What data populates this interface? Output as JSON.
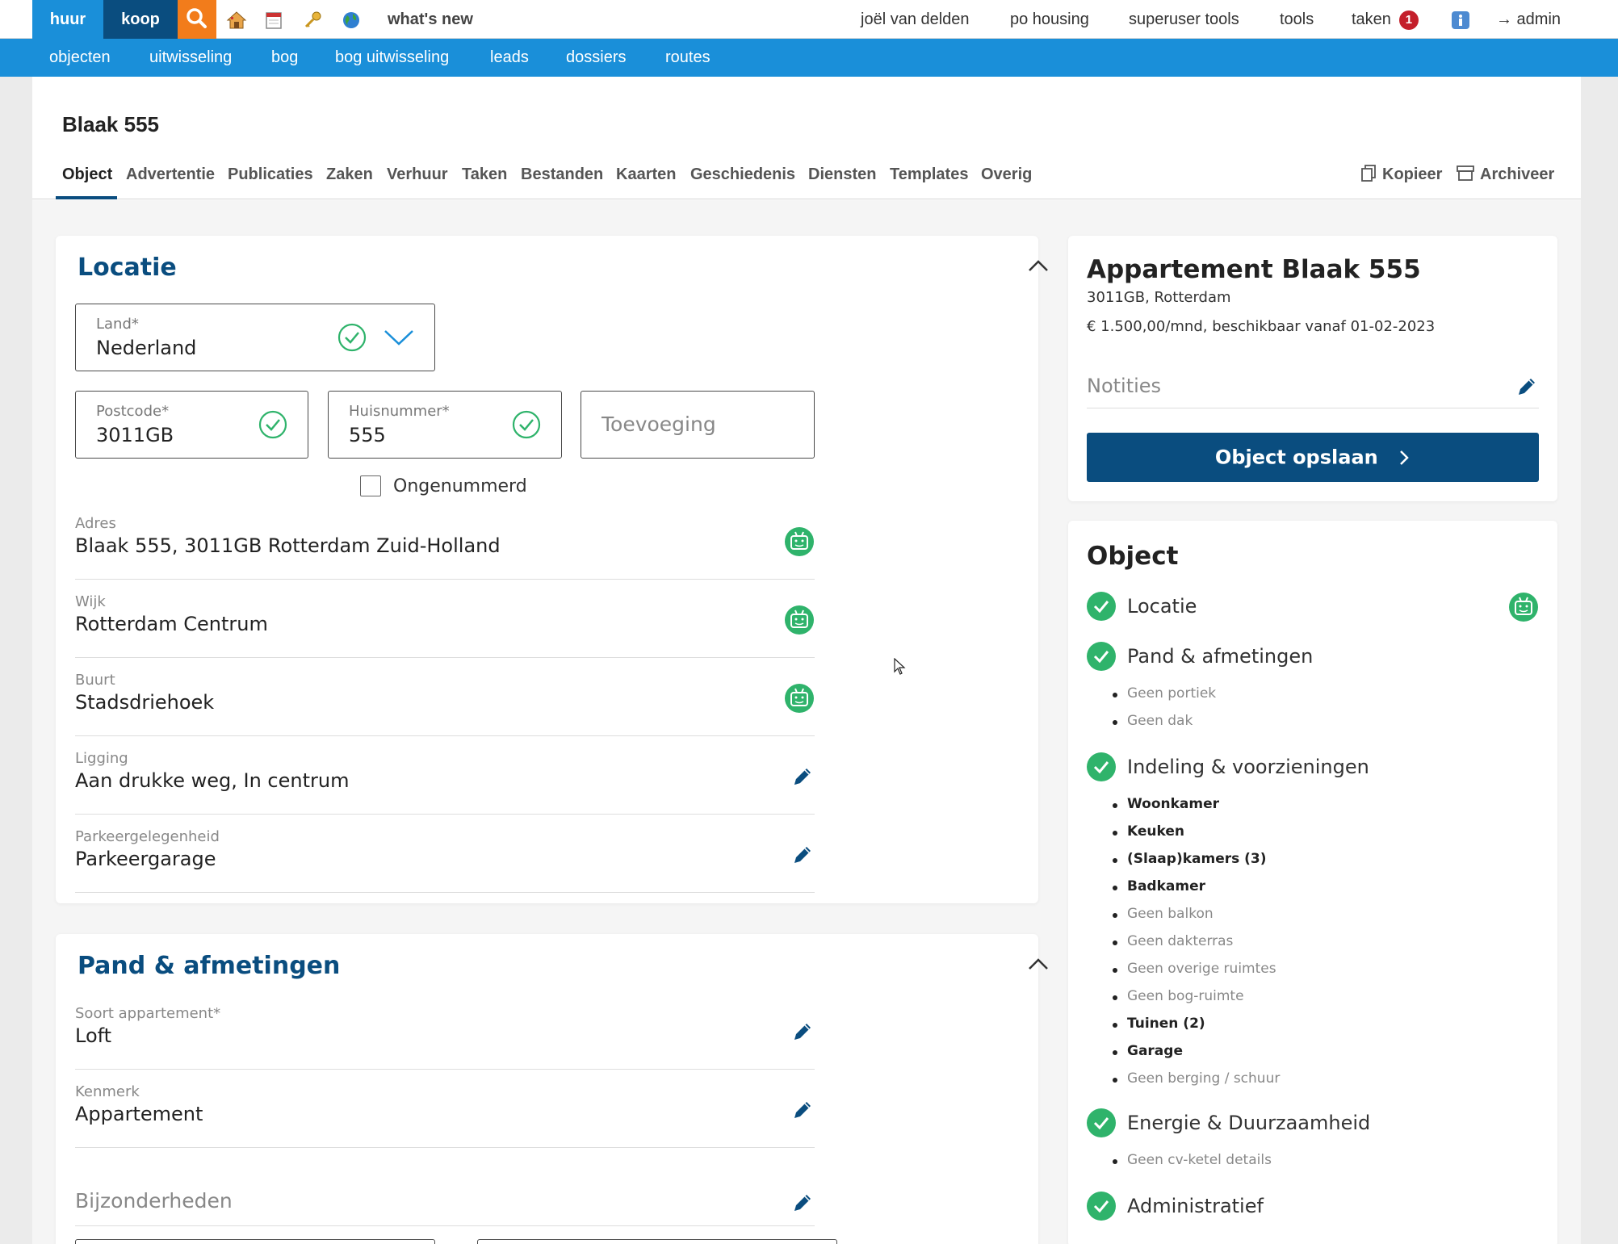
{
  "topbar": {
    "huur": "huur",
    "koop": "koop",
    "whats_new": "what's new",
    "user": "joël van delden",
    "org": "po housing",
    "superuser": "superuser tools",
    "tools": "tools",
    "taken": "taken",
    "taken_count": "1",
    "admin": "→ admin"
  },
  "subnav": [
    "objecten",
    "uitwisseling",
    "bog",
    "bog uitwisseling",
    "leads",
    "dossiers",
    "routes"
  ],
  "page": {
    "title": "Blaak 555",
    "tabs": [
      "Object",
      "Advertentie",
      "Publicaties",
      "Zaken",
      "Verhuur",
      "Taken",
      "Bestanden",
      "Kaarten",
      "Geschiedenis",
      "Diensten",
      "Templates",
      "Overig"
    ],
    "active_tab": "Object",
    "actions": {
      "kopieer": "Kopieer",
      "archiveer": "Archiveer"
    }
  },
  "locatie": {
    "title": "Locatie",
    "land": {
      "label": "Land*",
      "value": "Nederland"
    },
    "postcode": {
      "label": "Postcode*",
      "value": "3011GB"
    },
    "huisnummer": {
      "label": "Huisnummer*",
      "value": "555"
    },
    "toevoeging": {
      "placeholder": "Toevoeging"
    },
    "ongenummerd": "Ongenummerd",
    "adres": {
      "label": "Adres",
      "value": "Blaak 555, 3011GB Rotterdam Zuid-Holland"
    },
    "wijk": {
      "label": "Wijk",
      "value": "Rotterdam Centrum"
    },
    "buurt": {
      "label": "Buurt",
      "value": "Stadsdriehoek"
    },
    "ligging": {
      "label": "Ligging",
      "value": "Aan drukke weg, In centrum"
    },
    "parkeer": {
      "label": "Parkeergelegenheid",
      "value": "Parkeergarage"
    }
  },
  "pand": {
    "title": "Pand & afmetingen",
    "soort": {
      "label": "Soort appartement*",
      "value": "Loft"
    },
    "kenmerk": {
      "label": "Kenmerk",
      "value": "Appartement"
    },
    "bijzonderheden": {
      "placeholder": "Bijzonderheden"
    }
  },
  "summary": {
    "title": "Appartement Blaak 555",
    "address": "3011GB, Rotterdam",
    "price": "€ 1.500,00/mnd, beschikbaar vanaf 01-02-2023",
    "notes_placeholder": "Notities",
    "save": "Object opslaan"
  },
  "object": {
    "title": "Object",
    "sections": [
      {
        "label": "Locatie"
      },
      {
        "label": "Pand & afmetingen",
        "items": [
          {
            "text": "Geen portiek",
            "on": false
          },
          {
            "text": "Geen dak",
            "on": false
          }
        ]
      },
      {
        "label": "Indeling & voorzieningen",
        "items": [
          {
            "text": "Woonkamer",
            "on": true
          },
          {
            "text": "Keuken",
            "on": true
          },
          {
            "text": "(Slaap)kamers (3)",
            "on": true
          },
          {
            "text": "Badkamer",
            "on": true
          },
          {
            "text": "Geen balkon",
            "on": false
          },
          {
            "text": "Geen dakterras",
            "on": false
          },
          {
            "text": "Geen overige ruimtes",
            "on": false
          },
          {
            "text": "Geen bog-ruimte",
            "on": false
          },
          {
            "text": "Tuinen (2)",
            "on": true
          },
          {
            "text": "Garage",
            "on": true
          },
          {
            "text": "Geen berging / schuur",
            "on": false
          }
        ]
      },
      {
        "label": "Energie & Duurzaamheid",
        "items": [
          {
            "text": "Geen cv-ketel details",
            "on": false
          }
        ]
      },
      {
        "label": "Administratief"
      }
    ]
  },
  "colors": {
    "brand_dark": "#0a4d7f",
    "brand_light": "#1a8fd9",
    "accent_orange": "#f27c1b",
    "check_green": "#2fb36b",
    "badge_red": "#c41f2b"
  }
}
